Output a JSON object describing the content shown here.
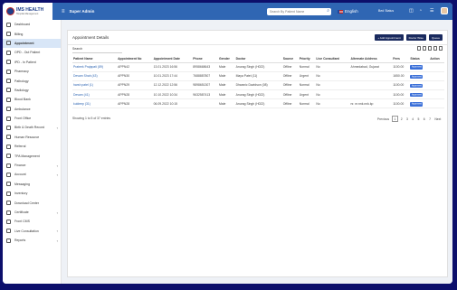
{
  "app": {
    "logo_title": "IMS HEALTH",
    "logo_subtitle": "Hospital Management",
    "role": "Super Admin",
    "search_placeholder": "Search By Patient Name",
    "language": "English",
    "bed_status": "Bed Status"
  },
  "sidebar": {
    "items": [
      {
        "label": "Dashboard"
      },
      {
        "label": "Billing"
      },
      {
        "label": "Appointment"
      },
      {
        "label": "OPD - Out Patient"
      },
      {
        "label": "IPD - In Patient"
      },
      {
        "label": "Pharmacy"
      },
      {
        "label": "Pathology"
      },
      {
        "label": "Radiology"
      },
      {
        "label": "Blood Bank"
      },
      {
        "label": "Ambulance"
      },
      {
        "label": "Front Office"
      },
      {
        "label": "Birth & Death Record"
      },
      {
        "label": "Human Resource"
      },
      {
        "label": "Referral"
      },
      {
        "label": "TPA Management"
      },
      {
        "label": "Finance"
      },
      {
        "label": "Account"
      },
      {
        "label": "Messaging"
      },
      {
        "label": "Inventory"
      },
      {
        "label": "Download Center"
      },
      {
        "label": "Certificate"
      },
      {
        "label": "Front CMS"
      },
      {
        "label": "Live Consultation"
      },
      {
        "label": "Reports"
      }
    ]
  },
  "panel": {
    "title": "Appointment Details",
    "buttons": [
      "+ Add Appointment",
      "Doctor Wise",
      "Queue"
    ],
    "search_label": "Search"
  },
  "table": {
    "columns": [
      "Patient Name",
      "Appointment No",
      "Appointment Date",
      "Phone",
      "Gender",
      "Doctor",
      "Source",
      "Priority",
      "Live Consultant",
      "Alternate Address",
      "Fees",
      "Status",
      "Action"
    ],
    "rows": [
      [
        "Prateek Prajapati (89)",
        "APPN42",
        "13.01.2023 16:56",
        "8958668643",
        "Male",
        "Anurag Singh (H022)",
        "Offline",
        "Normal",
        "No",
        "Ahmedabad, Gujarat",
        "1100.00",
        "Approved",
        ""
      ],
      [
        "Devam Shah (43)",
        "APPN30",
        "10.01.2023 17:44",
        "7688887807",
        "Male",
        "Maya Patel (11)",
        "Offline",
        "Urgent",
        "No",
        "",
        "1650.00",
        "Approved",
        ""
      ],
      [
        "harsh patel (1)",
        "APPN29",
        "12.12.2022 12:56",
        "9898651307",
        "Male",
        "Dhwanic Davidson (08)",
        "Offline",
        "Normal",
        "No",
        "",
        "1100.00",
        "Approved",
        ""
      ],
      [
        "Devam (41)",
        "APPN28",
        "10.10.2022 10:34",
        "9632587413",
        "Male",
        "Anurag Singh (H022)",
        "Offline",
        "Urgent",
        "No",
        "",
        "1100.00",
        "Approved",
        ""
      ],
      [
        "kuldeep (31)",
        "APPN28",
        "06.09.2022 10:15",
        "",
        "Male",
        "Anurag Singh (H022)",
        "Offline",
        "Normal",
        "No",
        "nr. nr.nnk.nnk.kp",
        "1100.00",
        "Approved",
        ""
      ]
    ]
  },
  "footer": {
    "info": "Showing 1 to 5 of 37 entries",
    "previous": "Previous",
    "pages": [
      "1",
      "2",
      "3",
      "4",
      "5",
      "6",
      "7"
    ],
    "next": "Next"
  }
}
